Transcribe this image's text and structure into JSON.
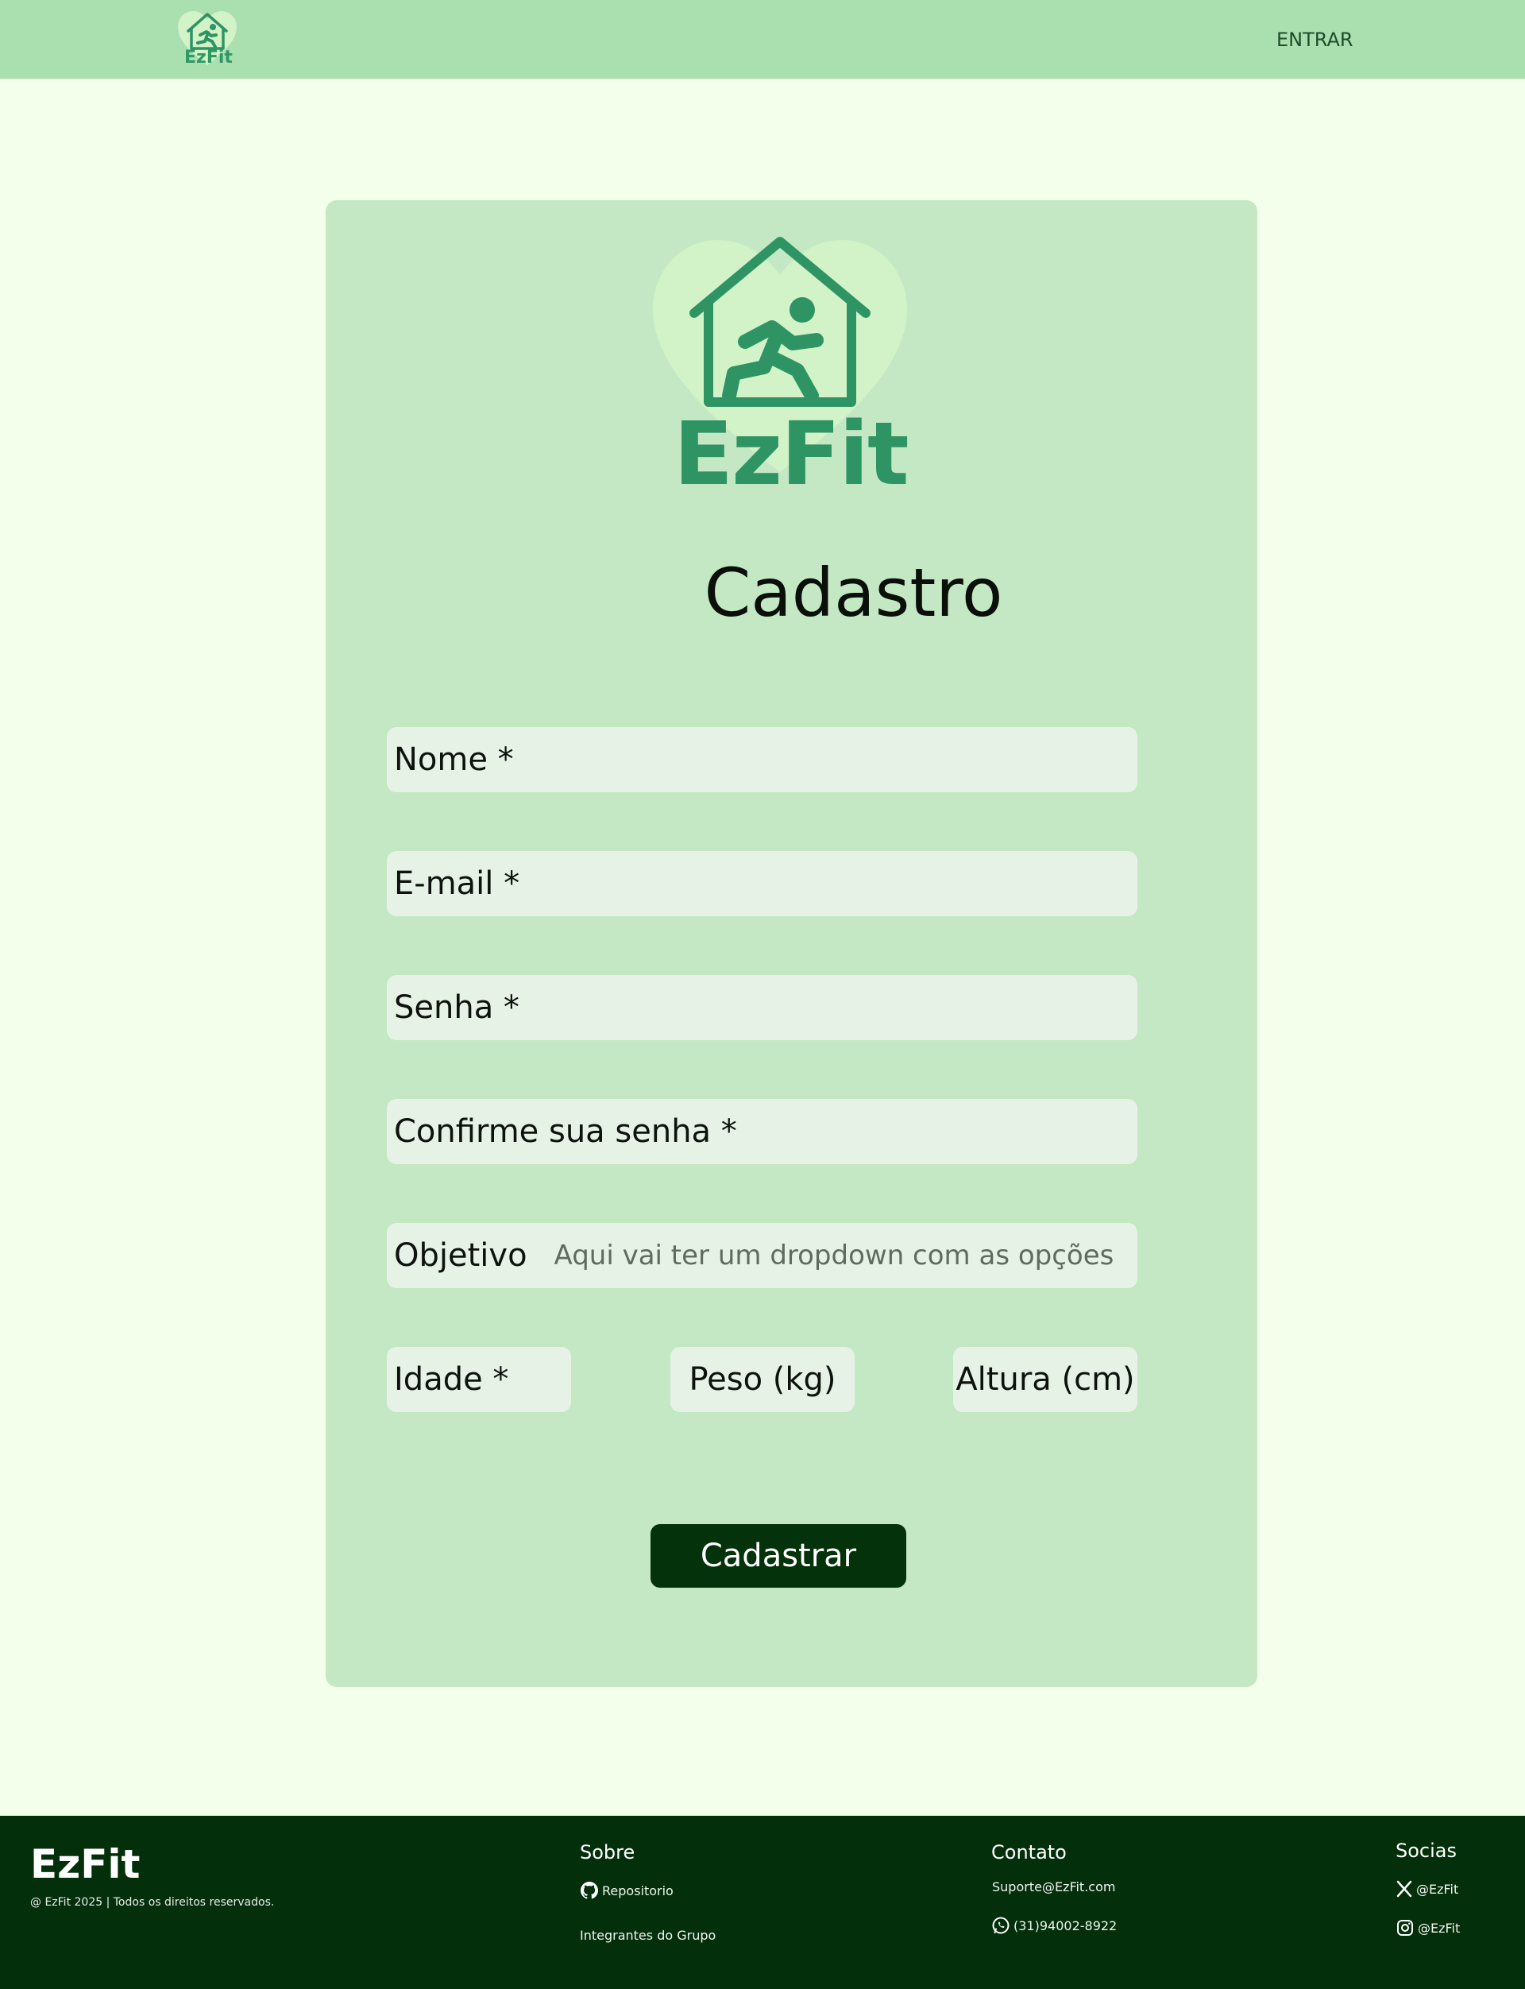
{
  "header": {
    "logo_text": "EzFit",
    "login_label": "ENTRAR"
  },
  "card": {
    "logo_text": "EzFit",
    "title": "Cadastro",
    "fields": {
      "nome": "Nome *",
      "email": "E-mail *",
      "senha": "Senha *",
      "confirme": "Confirme sua senha *",
      "objetivo": "Objetivo",
      "objetivo_placeholder": "Aqui vai ter um dropdown com as opções",
      "idade": "Idade *",
      "peso": "Peso (kg)",
      "altura": "Altura (cm)"
    },
    "submit_label": "Cadastrar"
  },
  "footer": {
    "brand": "EzFit",
    "copyright": "@ EzFit 2025 | Todos os direitos reservados.",
    "sobre": {
      "heading": "Sobre",
      "repo": "Repositorio",
      "team": "Integrantes do Grupo"
    },
    "contato": {
      "heading": "Contato",
      "email": "Suporte@EzFit.com",
      "phone": "(31)94002-8922"
    },
    "socias": {
      "heading": "Socias",
      "x_handle": "@EzFit",
      "instagram_handle": "@EzFit"
    }
  },
  "colors": {
    "page_bg": "#f4ffeb",
    "header_bg": "#aadfb0",
    "card_bg": "#c3e8c3",
    "field_bg": "#e6f2e6",
    "brand_green": "#2e9464",
    "button_bg": "#04320a",
    "footer_bg": "#042f0b"
  }
}
